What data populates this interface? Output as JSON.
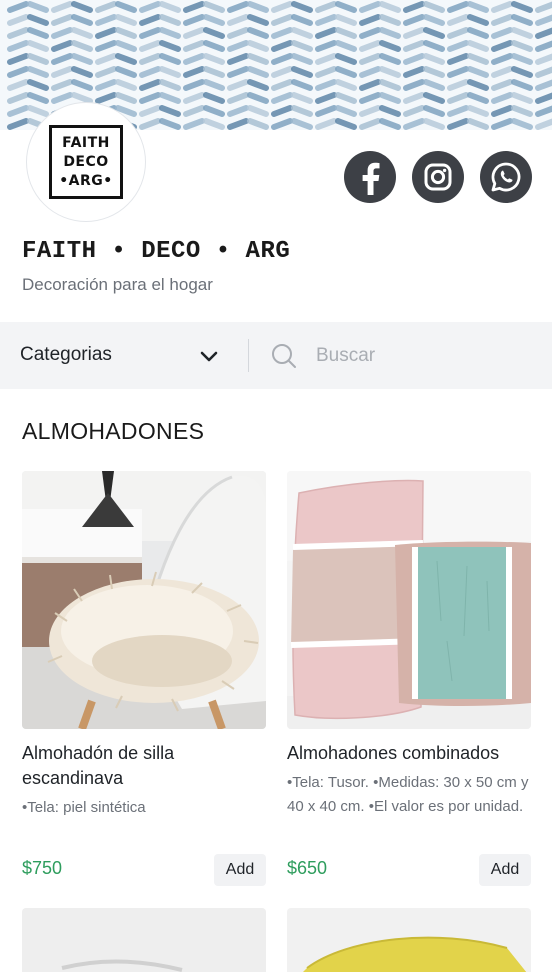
{
  "store": {
    "logo_lines": [
      "FAITH",
      "DECO",
      "•ARG•"
    ],
    "name": "FAITH • DECO • ARG",
    "tagline": "Decoración para el hogar"
  },
  "social": {
    "icons": [
      "facebook-icon",
      "instagram-icon",
      "whatsapp-icon"
    ],
    "button_color": "#3d4046"
  },
  "filter": {
    "category_label": "Categorias",
    "search_placeholder": "Buscar"
  },
  "section": {
    "title": "ALMOHADONES"
  },
  "products": [
    {
      "title": "Almohadón de silla escandinava",
      "description": "•Tela: piel sintética",
      "price": "$750",
      "add_label": "Add"
    },
    {
      "title": "Almohadones combinados",
      "description": "•Tela: Tusor. •Medidas: 30 x 50 cm y 40 x 40 cm. •El valor es por unidad.",
      "price": "$650",
      "add_label": "Add"
    }
  ],
  "colors": {
    "price": "#2e9d5d",
    "filter_bg": "#f3f4f6",
    "banner_stroke": "#7fa3c0"
  }
}
